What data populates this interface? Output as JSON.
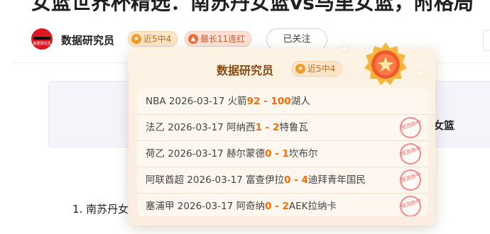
{
  "article": {
    "title": "女篮世界杯精选：南苏丹女篮vs马里女篮，附格局",
    "author": "数据研究员",
    "avatar_tag": "数据研究员",
    "badges": {
      "recent": "近5中4",
      "streak": "最长11连红"
    },
    "follow_label": "已关注",
    "card_tail_text": "女篮",
    "list_first": "1. 南苏丹女"
  },
  "popup": {
    "title": "数据研究员",
    "badge": "近5中4",
    "records": [
      {
        "league": "NBA",
        "date": "2026-03-17",
        "home": "火箭",
        "score_home": "92",
        "score_away": "100",
        "away": "湖人",
        "stamp": false
      },
      {
        "league": "法乙",
        "date": "2026-03-17",
        "home": "阿纳西",
        "score_home": "1",
        "score_away": "2",
        "away": "特鲁瓦",
        "stamp": true
      },
      {
        "league": "荷乙",
        "date": "2026-03-17",
        "home": "赫尔蒙德",
        "score_home": "0",
        "score_away": "1",
        "away": "坎布尔",
        "stamp": true
      },
      {
        "league": "阿联酋超",
        "date": "2026-03-17",
        "home": "富查伊拉",
        "score_home": "0",
        "score_away": "4",
        "away": "迪拜青年国民",
        "stamp": true
      },
      {
        "league": "塞浦甲",
        "date": "2026-03-17",
        "home": "阿奇纳",
        "score_home": "0",
        "score_away": "2",
        "away": "AEK拉纳卡",
        "stamp": true
      }
    ],
    "stamp_text": "预测命中",
    "score_separator": " - "
  },
  "colors": {
    "score": "#ff6a00",
    "badge_text": "#c86a14",
    "popup_title": "#8a4b10",
    "stamp": "#ee7070"
  },
  "icons": {
    "badge_recent": "star-icon",
    "badge_streak": "flame-icon",
    "medal": "medal-icon",
    "sparkle": "sparkle-icon"
  }
}
